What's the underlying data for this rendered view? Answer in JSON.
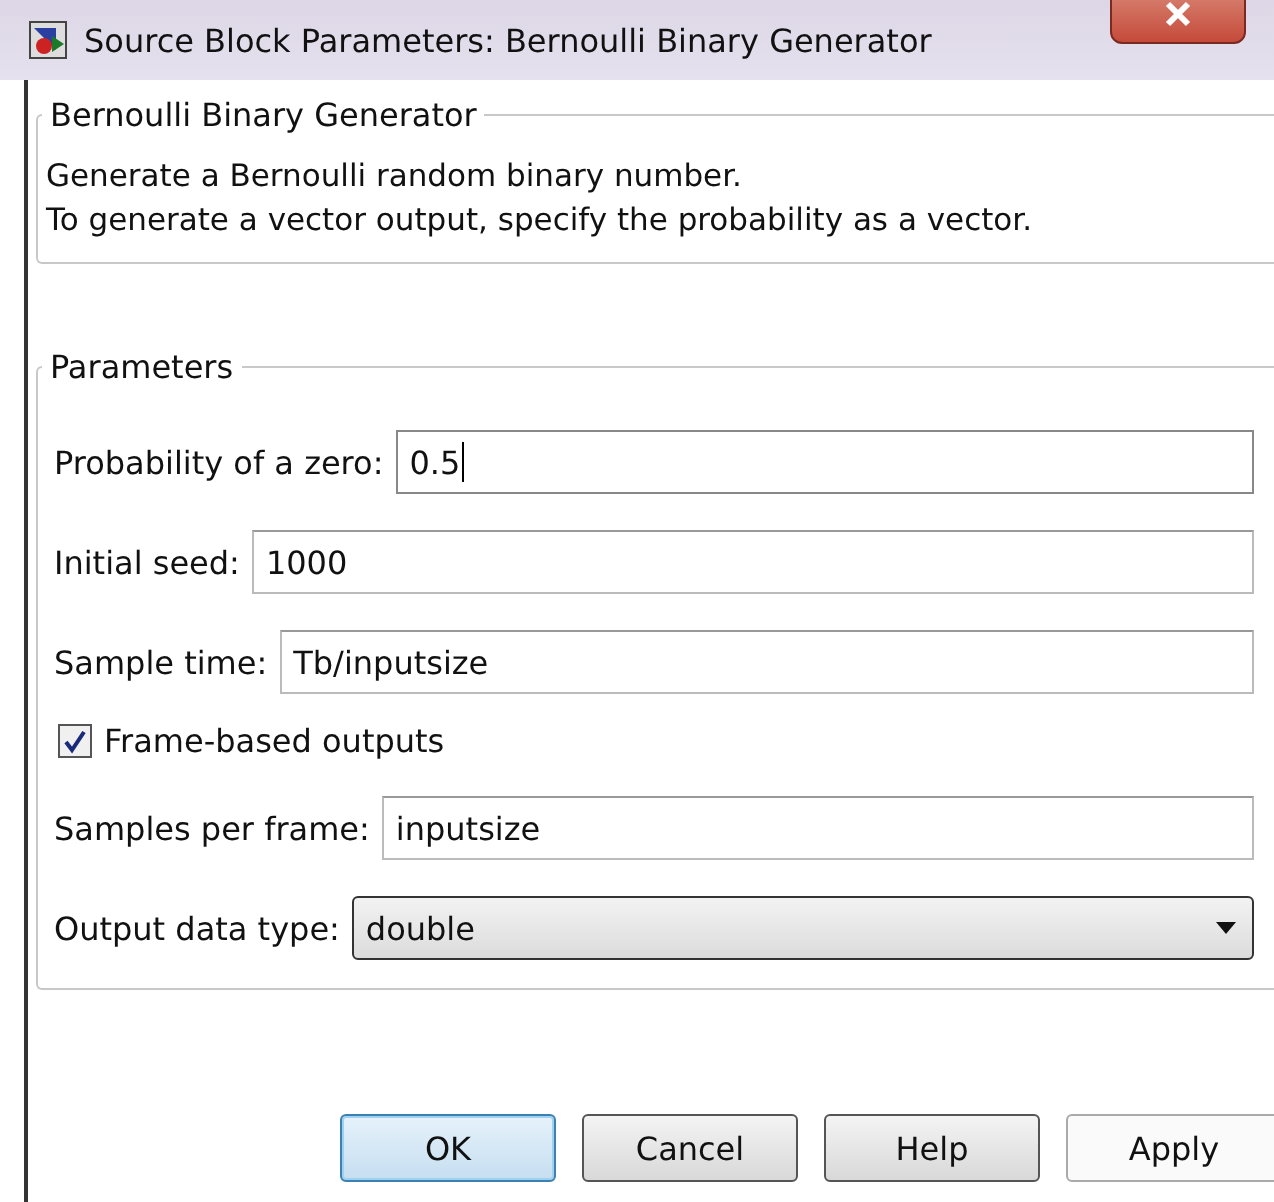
{
  "window": {
    "title": "Source Block Parameters: Bernoulli Binary Generator"
  },
  "description_group": {
    "title": "Bernoulli Binary Generator",
    "lines": [
      "Generate a Bernoulli random binary number.",
      "To generate a vector output, specify the probability as a vector."
    ]
  },
  "parameters_group": {
    "title": "Parameters",
    "items": [
      {
        "kind": "text",
        "label": "Probability of a zero:",
        "value": "0.5",
        "focused": true
      },
      {
        "kind": "text",
        "label": "Initial seed:",
        "value": "1000",
        "focused": false
      },
      {
        "kind": "text",
        "label": "Sample time:",
        "value": "Tb/inputsize",
        "focused": false
      },
      {
        "kind": "checkbox",
        "label": "Frame-based outputs",
        "checked": true
      },
      {
        "kind": "text",
        "label": "Samples per frame:",
        "value": "inputsize",
        "focused": false
      },
      {
        "kind": "dropdown",
        "label": "Output data type:",
        "value": "double"
      }
    ]
  },
  "buttons": [
    {
      "label": "OK",
      "default": true,
      "disabled": false
    },
    {
      "label": "Cancel",
      "default": false,
      "disabled": false
    },
    {
      "label": "Help",
      "default": false,
      "disabled": false
    },
    {
      "label": "Apply",
      "default": false,
      "disabled": true
    }
  ]
}
